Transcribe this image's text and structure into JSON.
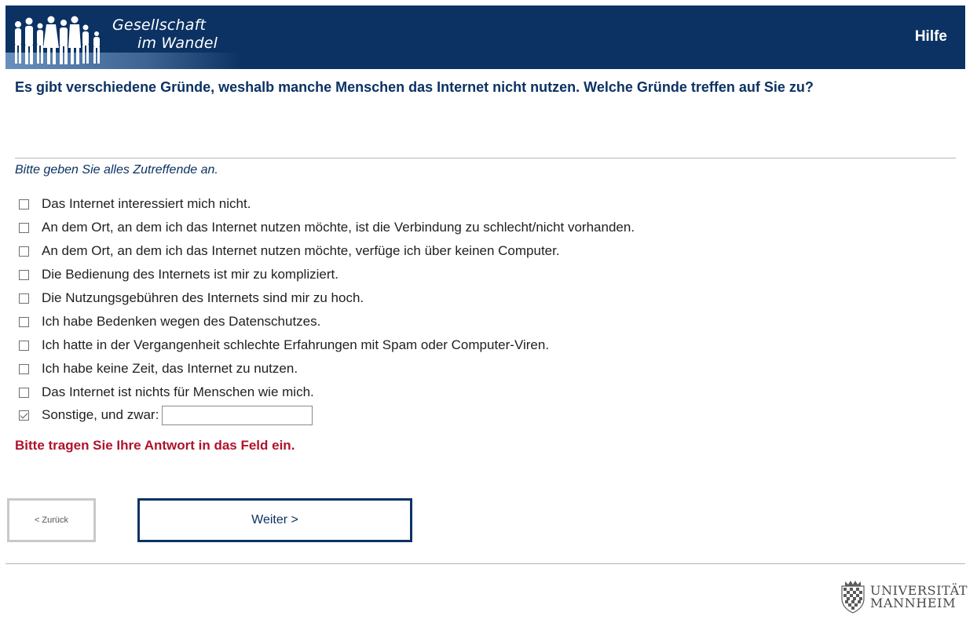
{
  "header": {
    "logo_line1": "Gesellschaft",
    "logo_line2": "im Wandel",
    "help_label": "Hilfe",
    "background_color": "#0c3263"
  },
  "question": {
    "text": "Es gibt verschiedene Gründe, weshalb manche Menschen das Internet nicht nutzen. Welche Gründe treffen auf Sie zu?",
    "instruction": "Bitte geben Sie alles Zutreffende an."
  },
  "options": [
    {
      "label": "Das Internet interessiert mich nicht.",
      "checked": false
    },
    {
      "label": "An dem Ort, an dem ich das Internet nutzen möchte, ist die Verbindung zu schlecht/nicht vorhanden.",
      "checked": false
    },
    {
      "label": "An dem Ort, an dem ich das Internet nutzen möchte, verfüge ich über keinen Computer.",
      "checked": false
    },
    {
      "label": "Die Bedienung des Internets ist mir zu kompliziert.",
      "checked": false
    },
    {
      "label": "Die Nutzungsgebühren des Internets sind mir zu hoch.",
      "checked": false
    },
    {
      "label": "Ich habe Bedenken wegen des Datenschutzes.",
      "checked": false
    },
    {
      "label": "Ich hatte in der Vergangenheit schlechte Erfahrungen mit Spam oder Computer-Viren.",
      "checked": false
    },
    {
      "label": "Ich habe keine Zeit, das Internet zu nutzen.",
      "checked": false
    },
    {
      "label": "Das Internet ist nichts für Menschen wie mich.",
      "checked": false
    }
  ],
  "other_option": {
    "label": "Sonstige, und zwar:",
    "checked": true,
    "value": ""
  },
  "error_message": "Bitte tragen Sie Ihre Antwort in das Feld ein.",
  "navigation": {
    "back_label": "< Zurück",
    "next_label": "Weiter >"
  },
  "footer": {
    "university_line1": "UNIVERSITÄT",
    "university_line2": "MANNHEIM"
  },
  "colors": {
    "primary": "#0c3263",
    "error": "#b0122a",
    "divider": "#b5b5b5"
  }
}
